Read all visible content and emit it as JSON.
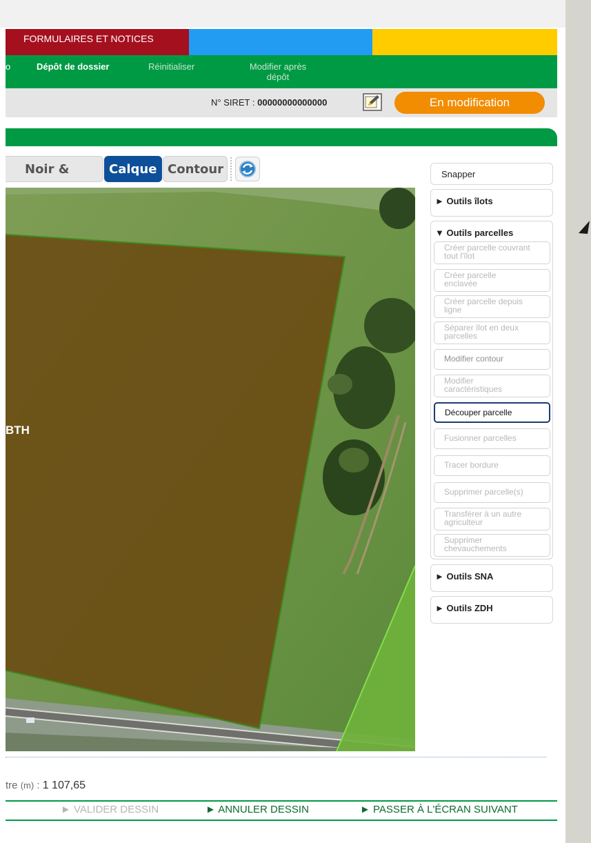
{
  "header": {
    "formulaires": "FORMULAIRES ET NOTICES"
  },
  "nav": {
    "item_cut": "o",
    "depot": "Dépôt de dossier",
    "reinit": "Réinitialiser",
    "modifier_line1": "Modifier après",
    "modifier_line2": "dépôt"
  },
  "siret": {
    "label": "N° SIRET :",
    "value": "00000000000000",
    "status": "En modification"
  },
  "view_tabs": {
    "noir_blanc": "Noir & blanc",
    "calque": "Calque",
    "contour": "Contour"
  },
  "map": {
    "parcel_label": "BTH"
  },
  "tools": {
    "snapper": "Snapper",
    "outils_ilots": "Outils îlots",
    "outils_parcelles": "Outils parcelles",
    "items": [
      {
        "line1": "Créer parcelle couvrant",
        "line2": "tout l'îlot"
      },
      {
        "line1": "Créer parcelle",
        "line2": "enclavée"
      },
      {
        "line1": "Créer parcelle depuis",
        "line2": "ligne"
      },
      {
        "line1": "Séparer îlot en deux",
        "line2": "parcelles"
      },
      {
        "line1": "Modifier contour"
      },
      {
        "line1": "Modifier",
        "line2": "caractéristiques"
      },
      {
        "line1": "Découper parcelle"
      },
      {
        "line1": "Fusionner parcelles"
      },
      {
        "line1": "Tracer bordure"
      },
      {
        "line1": "Supprimer parcelle(s)"
      },
      {
        "line1": "Transférer à un autre",
        "line2": "agriculteur"
      },
      {
        "line1": "Supprimer",
        "line2": "chevauchements"
      }
    ],
    "outils_sna": "Outils SNA",
    "outils_zdh": "Outils ZDH"
  },
  "footer": {
    "perimeter_label": "tre",
    "perimeter_unit": "(m)",
    "perimeter_sep": " : ",
    "perimeter_value": "1 107,65",
    "valider": "VALIDER DESSIN",
    "annuler": "ANNULER DESSIN",
    "passer": "PASSER À L'ÉCRAN SUIVANT"
  },
  "colors": {
    "brand_green": "#009a44",
    "status_orange": "#f28c00",
    "active_tab": "#0e4f9a"
  }
}
